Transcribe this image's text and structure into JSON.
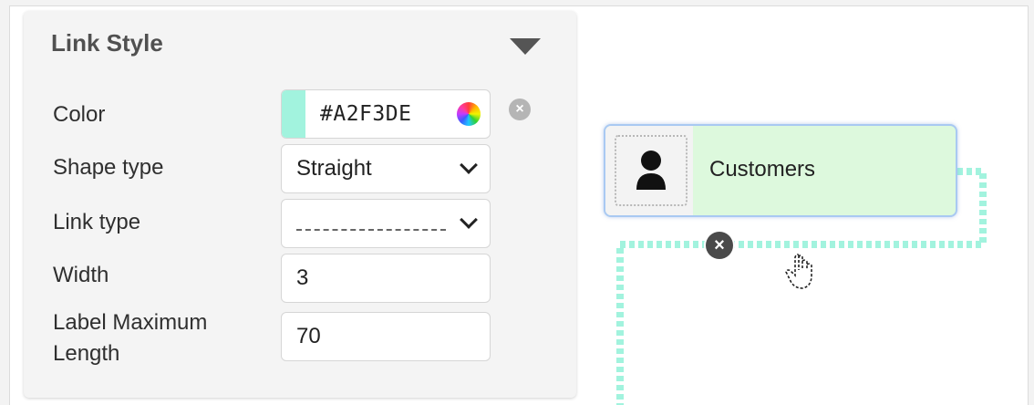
{
  "panel": {
    "title": "Link Style",
    "rows": {
      "color": {
        "label": "Color",
        "value": "#A2F3DE",
        "swatch": "#A2F3DE"
      },
      "shape_type": {
        "label": "Shape type",
        "value": "Straight"
      },
      "link_type": {
        "label": "Link type",
        "value": "dashed"
      },
      "width": {
        "label": "Width",
        "value": "3"
      },
      "label_max_length": {
        "label_line1": "Label Maximum",
        "label_line2": "Length",
        "value": "70"
      }
    }
  },
  "diagram": {
    "node": {
      "label": "Customers",
      "icon": "person-icon",
      "fill": "#DDF9DD",
      "border": "#A9C9F2"
    },
    "link": {
      "color": "#A2F3DE",
      "style": "dashed"
    },
    "delete_glyph": "×",
    "clear_glyph": "×"
  },
  "icons": [
    "chevron-down-icon",
    "color-picker-icon",
    "clear-icon",
    "person-icon",
    "hand-cursor-icon"
  ]
}
